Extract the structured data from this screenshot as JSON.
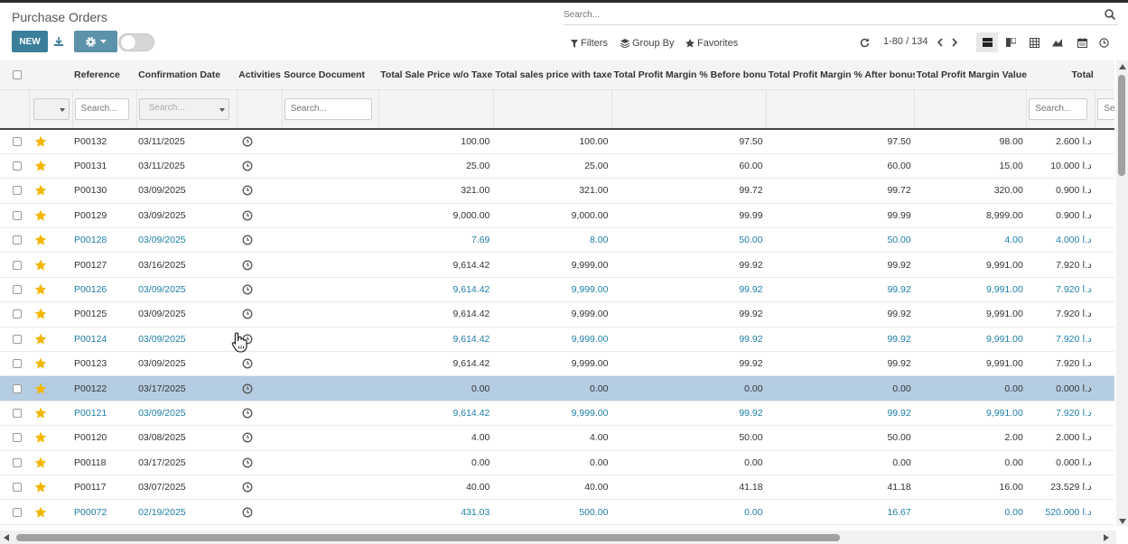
{
  "app": {
    "title": "Purchase Orders",
    "search_placeholder": "Search..."
  },
  "toolbar": {
    "new_label": "NEW",
    "filters_label": "Filters",
    "groupby_label": "Group By",
    "favorites_label": "Favorites",
    "pager_text": "1-80 / 134"
  },
  "table": {
    "headers": {
      "reference": "Reference",
      "confirmation_date": "Confirmation Date",
      "activities": "Activities",
      "source_document": "Source Document",
      "total_sale_wo_tax": "Total Sale Price w/o Taxes",
      "total_sales_with_tax": "Total sales price with taxes",
      "margin_before": "Total Profit Margin % Before bonus",
      "margin_after": "Total Profit Margin % After bonus",
      "margin_value": "Total Profit Margin Value",
      "total": "Total"
    },
    "filter_placeholder": "Search...",
    "currency_symbol": "د.ا",
    "rows": [
      {
        "ref": "P00132",
        "date": "03/11/2025",
        "sale": "100.00",
        "sales_tax": "100.00",
        "mb": "97.50",
        "ma": "97.50",
        "mv": "98.00",
        "total": "2.600",
        "style": "normal"
      },
      {
        "ref": "P00131",
        "date": "03/11/2025",
        "sale": "25.00",
        "sales_tax": "25.00",
        "mb": "60.00",
        "ma": "60.00",
        "mv": "15.00",
        "total": "10.000",
        "style": "normal"
      },
      {
        "ref": "P00130",
        "date": "03/09/2025",
        "sale": "321.00",
        "sales_tax": "321.00",
        "mb": "99.72",
        "ma": "99.72",
        "mv": "320.00",
        "total": "0.900",
        "style": "normal"
      },
      {
        "ref": "P00129",
        "date": "03/09/2025",
        "sale": "9,000.00",
        "sales_tax": "9,000.00",
        "mb": "99.99",
        "ma": "99.99",
        "mv": "8,999.00",
        "total": "0.900",
        "style": "normal"
      },
      {
        "ref": "P00128",
        "date": "03/09/2025",
        "sale": "7.69",
        "sales_tax": "8.00",
        "mb": "50.00",
        "ma": "50.00",
        "mv": "4.00",
        "total": "4.000",
        "style": "blue"
      },
      {
        "ref": "P00127",
        "date": "03/16/2025",
        "sale": "9,614.42",
        "sales_tax": "9,999.00",
        "mb": "99.92",
        "ma": "99.92",
        "mv": "9,991.00",
        "total": "7.920",
        "style": "normal"
      },
      {
        "ref": "P00126",
        "date": "03/09/2025",
        "sale": "9,614.42",
        "sales_tax": "9,999.00",
        "mb": "99.92",
        "ma": "99.92",
        "mv": "9,991.00",
        "total": "7.920",
        "style": "blue"
      },
      {
        "ref": "P00125",
        "date": "03/09/2025",
        "sale": "9,614.42",
        "sales_tax": "9,999.00",
        "mb": "99.92",
        "ma": "99.92",
        "mv": "9,991.00",
        "total": "7.920",
        "style": "normal"
      },
      {
        "ref": "P00124",
        "date": "03/09/2025",
        "sale": "9,614.42",
        "sales_tax": "9,999.00",
        "mb": "99.92",
        "ma": "99.92",
        "mv": "9,991.00",
        "total": "7.920",
        "style": "blue"
      },
      {
        "ref": "P00123",
        "date": "03/09/2025",
        "sale": "9,614.42",
        "sales_tax": "9,999.00",
        "mb": "99.92",
        "ma": "99.92",
        "mv": "9,991.00",
        "total": "7.920",
        "style": "normal"
      },
      {
        "ref": "P00122",
        "date": "03/17/2025",
        "sale": "0.00",
        "sales_tax": "0.00",
        "mb": "0.00",
        "ma": "0.00",
        "mv": "0.00",
        "total": "0.000",
        "style": "selected"
      },
      {
        "ref": "P00121",
        "date": "03/09/2025",
        "sale": "9,614.42",
        "sales_tax": "9,999.00",
        "mb": "99.92",
        "ma": "99.92",
        "mv": "9,991.00",
        "total": "7.920",
        "style": "blue"
      },
      {
        "ref": "P00120",
        "date": "03/08/2025",
        "sale": "4.00",
        "sales_tax": "4.00",
        "mb": "50.00",
        "ma": "50.00",
        "mv": "2.00",
        "total": "2.000",
        "style": "normal"
      },
      {
        "ref": "P00118",
        "date": "03/17/2025",
        "sale": "0.00",
        "sales_tax": "0.00",
        "mb": "0.00",
        "ma": "0.00",
        "mv": "0.00",
        "total": "0.000",
        "style": "normal"
      },
      {
        "ref": "P00117",
        "date": "03/07/2025",
        "sale": "40.00",
        "sales_tax": "40.00",
        "mb": "41.18",
        "ma": "41.18",
        "mv": "16.00",
        "total": "23.529",
        "style": "normal"
      },
      {
        "ref": "P00072",
        "date": "02/19/2025",
        "sale": "431.03",
        "sales_tax": "500.00",
        "mb": "0.00",
        "ma": "16.67",
        "mv": "0.00",
        "total": "520.000",
        "style": "blue"
      }
    ]
  },
  "colors": {
    "primary": "#3a7f9a",
    "link_blue": "#1d7ea6",
    "star": "#f3b700",
    "selected_row": "#b5cde2"
  },
  "icons": [
    "search-icon",
    "download-icon",
    "gear-icon",
    "filter-icon",
    "layers-icon",
    "star-icon",
    "refresh-icon",
    "list-view-icon",
    "kanban-view-icon",
    "pivot-view-icon",
    "graph-view-icon",
    "calendar-view-icon",
    "activity-view-icon",
    "clock-icon",
    "hand-cursor-icon"
  ]
}
